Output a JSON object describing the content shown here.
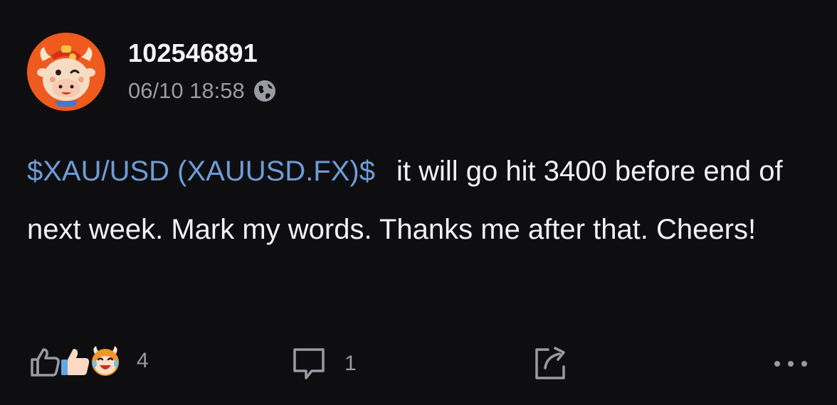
{
  "post": {
    "author": {
      "username": "102546891",
      "avatar_icon": "bull-mascot-avatar"
    },
    "timestamp": "06/10 18:58",
    "visibility_icon": "globe-icon",
    "ticker": "$XAU/USD (XAUUSD.FX)$",
    "body": "it will go hit 3400 before end of next week. Mark my words. Thanks me after that. Cheers!"
  },
  "actions": {
    "like_count": "4",
    "comment_count": "1",
    "reactions": [
      "thumbs-up-outline-icon",
      "thumbs-up-emoji-icon",
      "bull-laughing-emoji-icon"
    ],
    "share_icon": "share-icon",
    "more_icon": "more-dots-icon"
  },
  "colors": {
    "background": "#0e0e10",
    "text": "#f2f2f4",
    "muted": "#9a9aa2",
    "ticker": "#6f9bd8",
    "avatar_bg": "#ef5a1e"
  }
}
